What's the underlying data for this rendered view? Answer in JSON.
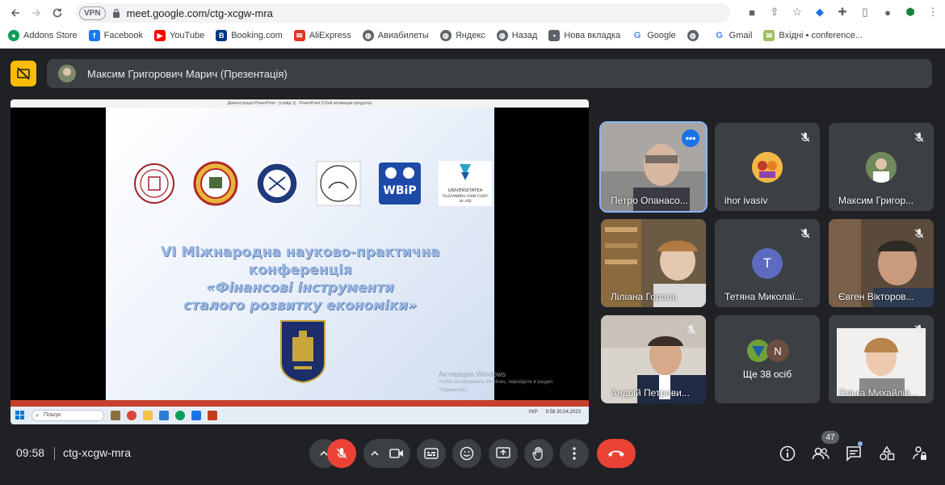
{
  "browser": {
    "url": "meet.google.com/ctg-xcgw-mra",
    "vpn_label": "VPN",
    "bookmarks": [
      {
        "label": "Addons Store",
        "icon": "addons-store-icon",
        "color": "#0f9d58"
      },
      {
        "label": "Facebook",
        "icon": "facebook-icon",
        "color": "#1877f2"
      },
      {
        "label": "YouTube",
        "icon": "youtube-icon",
        "color": "#ff0000"
      },
      {
        "label": "Booking.com",
        "icon": "booking-icon",
        "color": "#003580"
      },
      {
        "label": "AliExpress",
        "icon": "aliexpress-icon",
        "color": "#e43225"
      },
      {
        "label": "Авиабилеты",
        "icon": "globe-icon",
        "color": "#5f6368"
      },
      {
        "label": "Яндекс",
        "icon": "globe-icon",
        "color": "#5f6368"
      },
      {
        "label": "Назад",
        "icon": "globe-icon",
        "color": "#5f6368"
      },
      {
        "label": "Нова вкладка",
        "icon": "new-tab-icon",
        "color": "#5f6368"
      },
      {
        "label": "Google",
        "icon": "google-icon",
        "color": "#4285f4"
      },
      {
        "label": "",
        "icon": "globe-icon",
        "color": "#5f6368"
      },
      {
        "label": "Gmail",
        "icon": "google-icon",
        "color": "#4285f4"
      },
      {
        "label": "Вхідні • conference...",
        "icon": "gmail-inbox-icon",
        "color": "#a0c060"
      }
    ]
  },
  "meet": {
    "presenter_label": "Максим Григорович Марич (Презентація)",
    "time": "09:58",
    "meeting_code": "ctg-xcgw-mra",
    "participants_count": "47",
    "accent": "#8ab4f8",
    "end_call_color": "#ea4335"
  },
  "presentation": {
    "window_title": "Демонстрація PowerPoint - [слайд 1] - PowerPoint (Сбой активации продукта)",
    "slide_title_line1": "VI Міжнародна науково-практична",
    "slide_title_line2": "конференція",
    "slide_title_line3": "«Фінансові інструменти",
    "slide_title_line4": "сталого розвитку економіки»",
    "logo_wbip": "WBiP",
    "logo_univ_line1": "UNIVERSITATEA",
    "logo_univ_line2": "\"ALEXANDRU IOAN CUZA\"",
    "logo_univ_line3": "din IAŞI",
    "watermark_title": "Активация Windows",
    "watermark_sub": "Чтобы активировать Windows, перейдите в раздел \"Параметры\".",
    "taskbar_search": "Пошук",
    "taskbar_lang": "УКР",
    "taskbar_time": "9:58",
    "taskbar_date": "20.04.2023"
  },
  "tiles": [
    {
      "name": "Петро Опанасо...",
      "type": "video",
      "active": true,
      "muted": false
    },
    {
      "name": "ihor ivasiv",
      "type": "avatar",
      "muted": true
    },
    {
      "name": "Максим Григор...",
      "type": "avatar",
      "muted": true
    },
    {
      "name": "Лілiана Гораль",
      "type": "video",
      "muted": false
    },
    {
      "name": "Тетяна Миколаї...",
      "type": "letter",
      "letter": "T",
      "muted": true
    },
    {
      "name": "Євген Вікторов...",
      "type": "video",
      "muted": true
    },
    {
      "name": "Андрій Петрови...",
      "type": "video",
      "muted": true
    },
    {
      "name": "Ще 38 осіб",
      "type": "more",
      "letter": "N",
      "muted": false
    },
    {
      "name": "Ольга Михайлів...",
      "type": "video",
      "muted": true
    }
  ]
}
